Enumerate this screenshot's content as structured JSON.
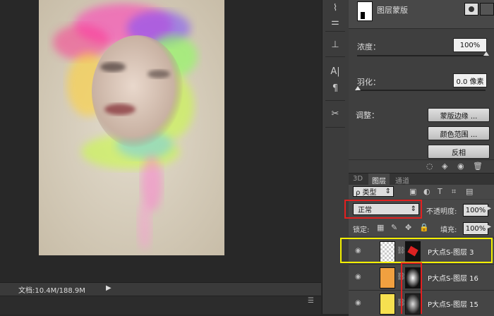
{
  "status": {
    "doc_info": "文档:10.4M/188.9M"
  },
  "panel": {
    "mask_title": "图层蒙版",
    "density": {
      "label": "浓度：",
      "value": "100%"
    },
    "feather": {
      "label": "羽化：",
      "value": "0.0 像素"
    },
    "adjust": {
      "label": "调整：",
      "edge_btn": "蒙版边缘 ...",
      "color_range_btn": "颜色范围 ...",
      "invert_btn": "反相"
    },
    "tabs": {
      "tab_3d": "3D",
      "tab_layers": "图层",
      "tab_channels": "通道"
    },
    "filter": {
      "kind_label": "ρ 类型"
    },
    "blend_mode": "正常",
    "opacity": {
      "label": "不透明度:",
      "value": "100%"
    },
    "lock": {
      "label": "锁定:"
    },
    "fill": {
      "label": "填充:",
      "value": "100%"
    },
    "layers": [
      {
        "name": "P大点S-图层 3"
      },
      {
        "name": "P大点S-图层 16"
      },
      {
        "name": "P大点S-图层 15"
      }
    ]
  },
  "colors": {
    "highlight_yellow": "#f4f000",
    "highlight_red": "#e22020"
  }
}
